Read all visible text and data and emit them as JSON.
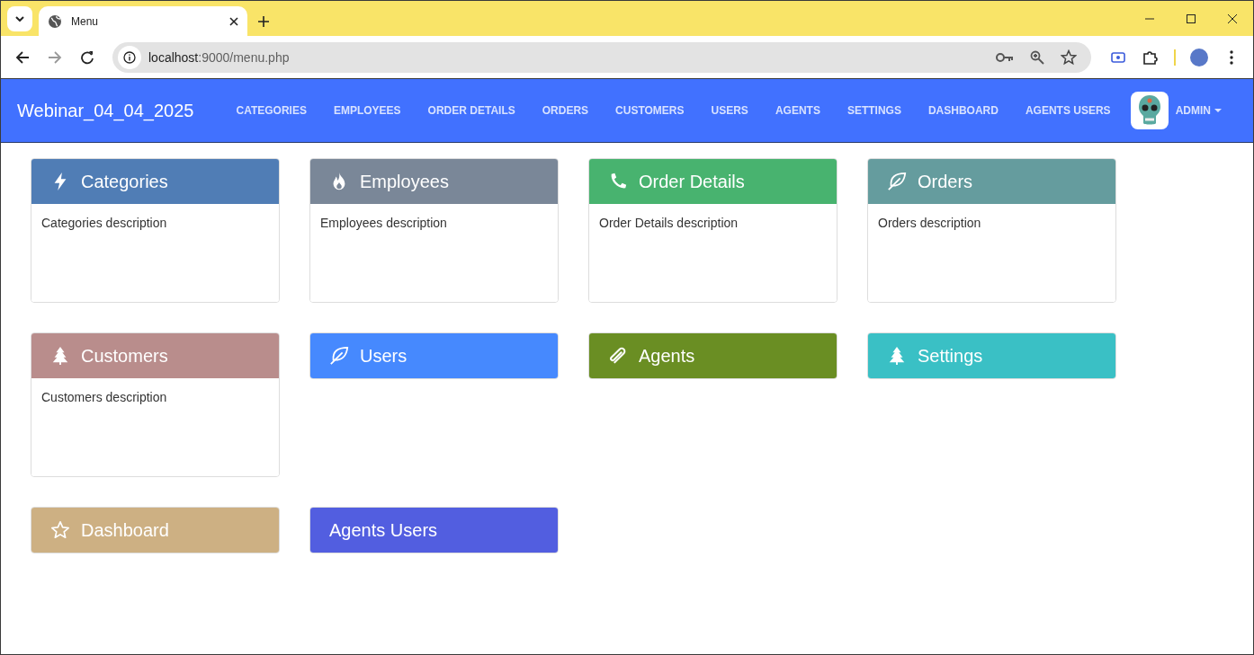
{
  "browser": {
    "tab_title": "Menu",
    "url_host": "localhost",
    "url_rest": ":9000/menu.php"
  },
  "navbar": {
    "brand": "Webinar_04_04_2025",
    "items": [
      "CATEGORIES",
      "EMPLOYEES",
      "ORDER DETAILS",
      "ORDERS",
      "CUSTOMERS",
      "USERS",
      "AGENTS",
      "SETTINGS",
      "DASHBOARD",
      "AGENTS USERS"
    ],
    "user": "ADMIN"
  },
  "cards": [
    {
      "title": "Categories",
      "kind": "bolt",
      "color": "#507db5",
      "description": "Categories description"
    },
    {
      "title": "Employees",
      "kind": "fire",
      "color": "#7a8798",
      "description": "Employees description"
    },
    {
      "title": "Order Details",
      "kind": "phone",
      "color": "#48b36f",
      "description": "Order Details description"
    },
    {
      "title": "Orders",
      "kind": "leaf",
      "color": "#659c9e",
      "description": "Orders description"
    },
    {
      "title": "Customers",
      "kind": "tree",
      "color": "#b98d8c",
      "description": "Customers description"
    },
    {
      "title": "Users",
      "kind": "leaf",
      "color": "#4689fe"
    },
    {
      "title": "Agents",
      "kind": "paperclip",
      "color": "#6a8e23"
    },
    {
      "title": "Settings",
      "kind": "tree",
      "color": "#3ac0c5"
    },
    {
      "title": "Dashboard",
      "kind": "star",
      "color": "#cdb083"
    },
    {
      "title": "Agents Users",
      "kind": "plain",
      "color": "#525ee0"
    }
  ]
}
